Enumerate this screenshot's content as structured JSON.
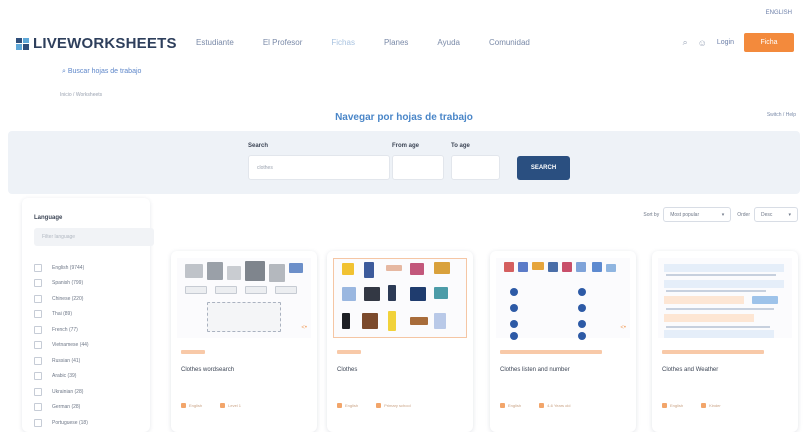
{
  "header": {
    "language": "ENGLISH",
    "brand": "LIVEWORKSHEETS",
    "nav": [
      "Estudiante",
      "El Profesor",
      "Fichas",
      "Planes",
      "Ayuda",
      "Comunidad"
    ],
    "login": "Login",
    "signup": "Ficha"
  },
  "search_link": "Buscar hojas de trabajo",
  "breadcrumb": "Inicio / Worksheets",
  "page": {
    "title": "Navegar por hojas de trabajo",
    "help": "Switch / Help"
  },
  "search": {
    "search_label": "Search",
    "search_value": "clothes",
    "from_age_label": "From age",
    "to_age_label": "To age",
    "button": "SEARCH"
  },
  "sidebar": {
    "title": "Language",
    "filter_placeholder": "Filter language",
    "languages": [
      "English (9744)",
      "Spanish (799)",
      "Chinese (220)",
      "Thai (89)",
      "French (77)",
      "Vietnamese (44)",
      "Russian (41)",
      "Arabic (39)",
      "Ukrainian (28)",
      "German (28)",
      "Portuguese (18)"
    ]
  },
  "sort": {
    "sort_label": "Sort by",
    "sort_value": "Most popular",
    "order_label": "Order",
    "order_value": "Desc"
  },
  "cards": [
    {
      "title": "Clothes wordsearch",
      "tag_visible": true,
      "foot_a": "English",
      "foot_b": "Level 1"
    },
    {
      "title": "Clothes",
      "tag_visible": true,
      "foot_a": "English",
      "foot_b": "Primary school"
    },
    {
      "title": "Clothes listen and number",
      "tag_visible": true,
      "foot_a": "English",
      "foot_b": "4-6 Years old"
    },
    {
      "title": "Clothes and Weather",
      "tag_visible": true,
      "foot_a": "English",
      "foot_b": "Kinder"
    }
  ],
  "colors": {
    "brand_navy": "#2e3f5c",
    "accent_orange": "#f38a3c",
    "title_blue": "#4a86c8",
    "button_navy": "#2a4f80"
  }
}
